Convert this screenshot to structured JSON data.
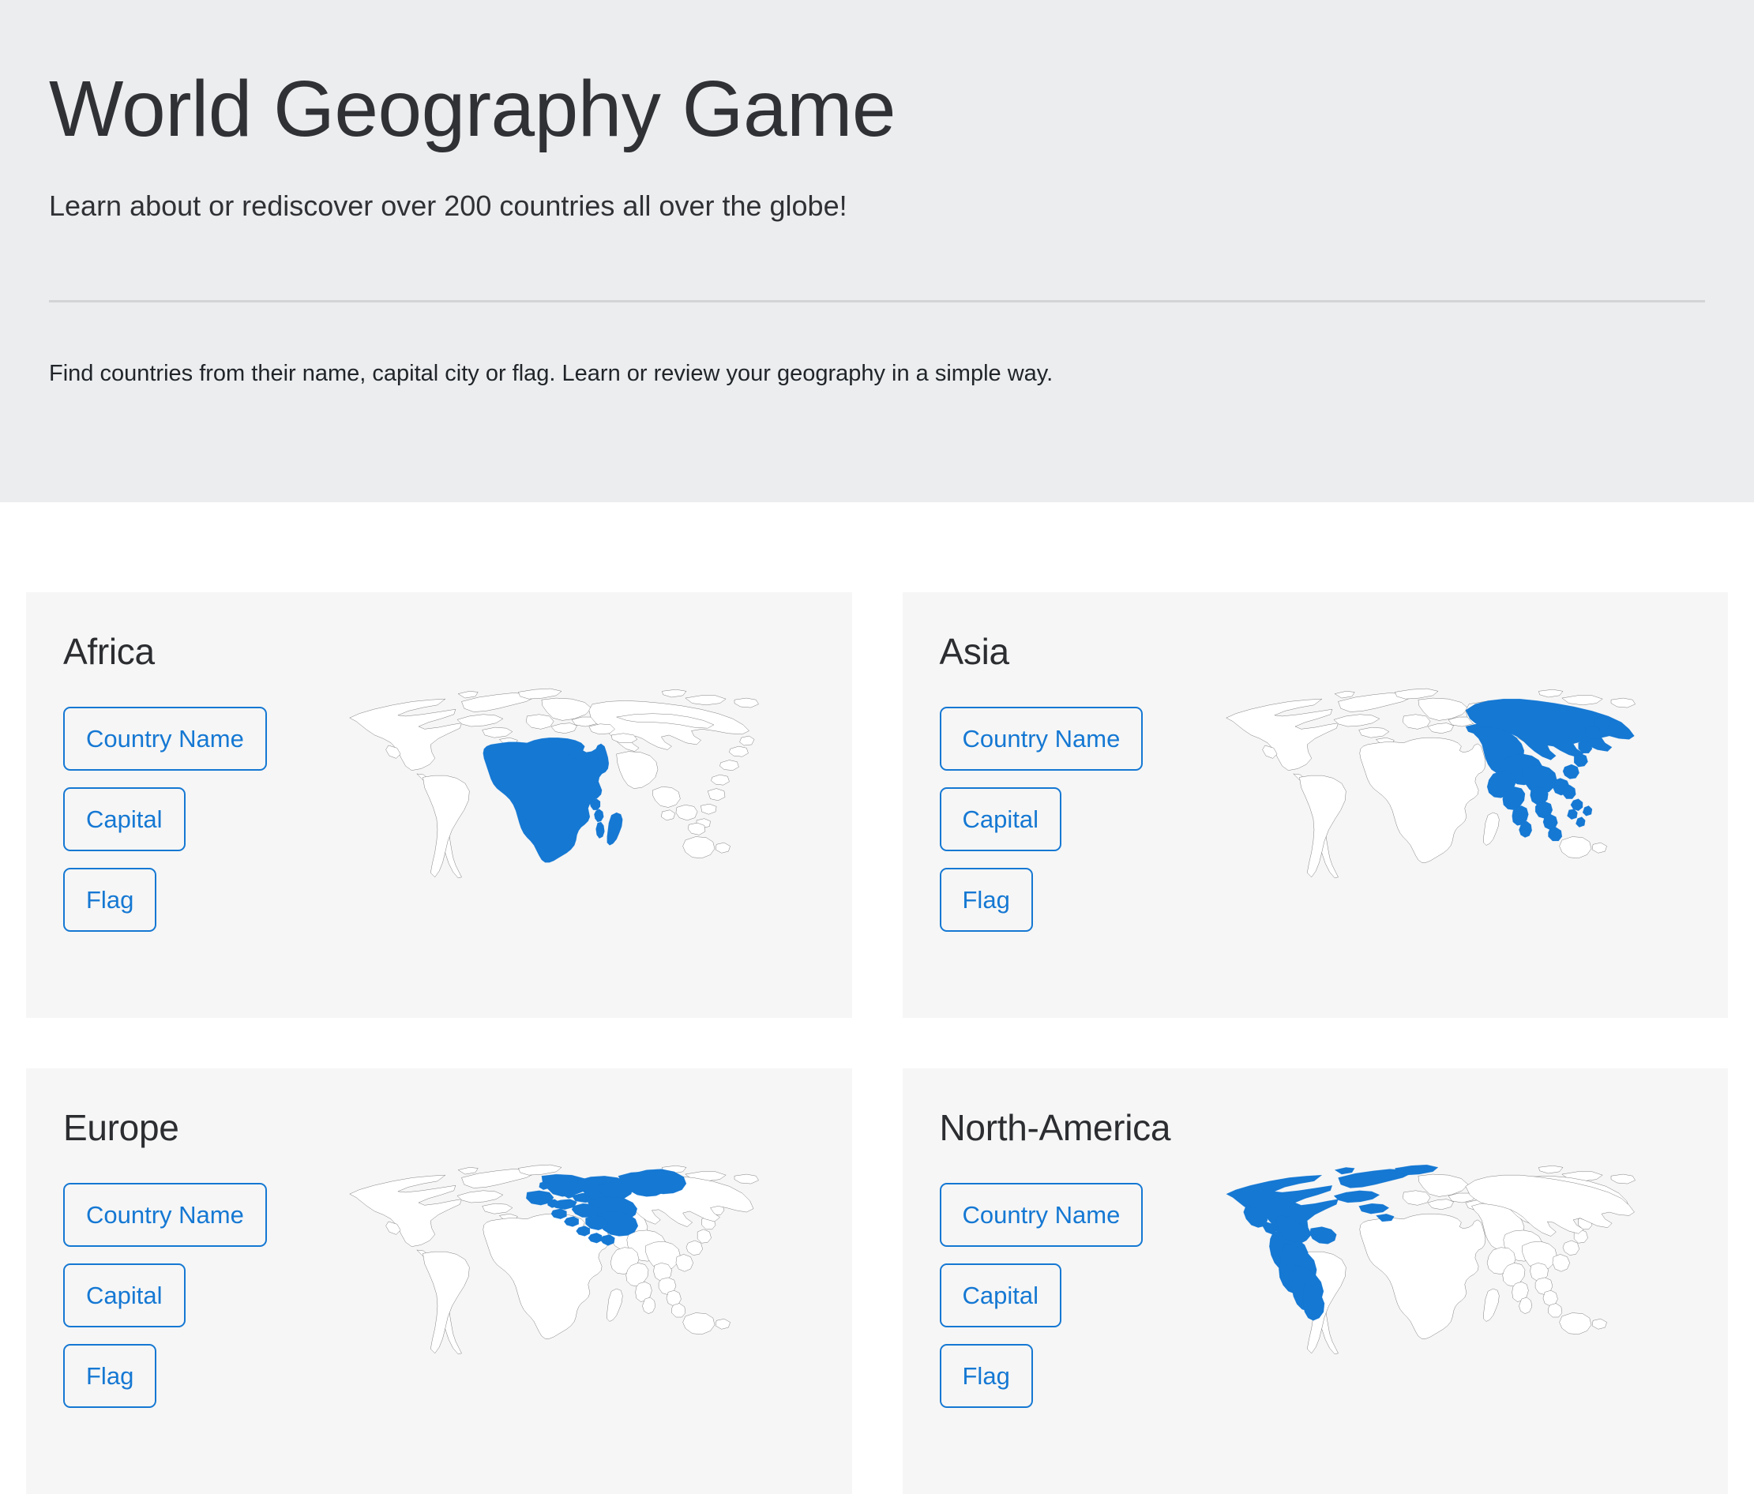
{
  "header": {
    "title": "World Geography Game",
    "lead": "Learn about or rediscover over 200 countries all over the globe!",
    "description": "Find countries from their name, capital city or flag. Learn or review your geography in a simple way."
  },
  "colors": {
    "accent": "#1578d3",
    "header_bg": "#ebedef",
    "card_bg": "#f6f6f6",
    "page_bg": "#ffffff",
    "divider": "#d3d4d6",
    "heading_text": "#2b2d30",
    "map_outline": "#2b2b2b",
    "map_highlight": "#1578d3"
  },
  "cards": [
    {
      "id": "africa",
      "title": "Africa",
      "map_icon": "world-map-africa-highlighted",
      "buttons": [
        {
          "label": "Country Name",
          "name": "country-name-button"
        },
        {
          "label": "Capital",
          "name": "capital-button"
        },
        {
          "label": "Flag",
          "name": "flag-button"
        }
      ]
    },
    {
      "id": "asia",
      "title": "Asia",
      "map_icon": "world-map-asia-highlighted",
      "buttons": [
        {
          "label": "Country Name",
          "name": "country-name-button"
        },
        {
          "label": "Capital",
          "name": "capital-button"
        },
        {
          "label": "Flag",
          "name": "flag-button"
        }
      ]
    },
    {
      "id": "europe",
      "title": "Europe",
      "map_icon": "world-map-europe-highlighted",
      "buttons": [
        {
          "label": "Country Name",
          "name": "country-name-button"
        },
        {
          "label": "Capital",
          "name": "capital-button"
        },
        {
          "label": "Flag",
          "name": "flag-button"
        }
      ]
    },
    {
      "id": "north-america",
      "title": "North-America",
      "map_icon": "world-map-north-america-highlighted",
      "buttons": [
        {
          "label": "Country Name",
          "name": "country-name-button"
        },
        {
          "label": "Capital",
          "name": "capital-button"
        },
        {
          "label": "Flag",
          "name": "flag-button"
        }
      ]
    }
  ]
}
